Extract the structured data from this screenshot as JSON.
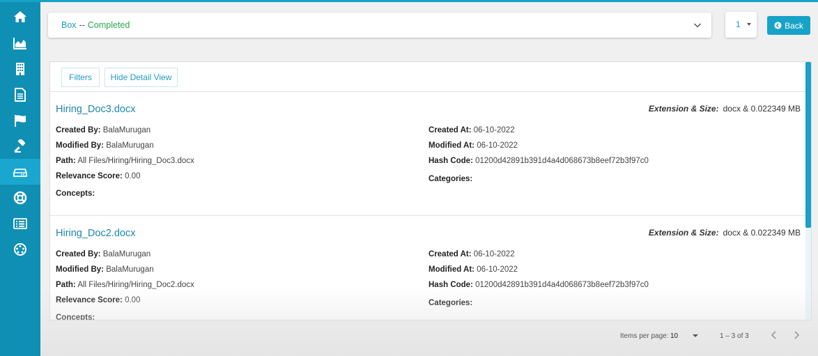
{
  "sidebar": {
    "items": [
      {
        "icon": "home-icon"
      },
      {
        "icon": "chart-area-icon"
      },
      {
        "icon": "building-icon"
      },
      {
        "icon": "document-icon"
      },
      {
        "icon": "flag-icon"
      },
      {
        "icon": "gavel-icon"
      },
      {
        "icon": "drive-icon",
        "active": true
      },
      {
        "icon": "lifebuoy-icon"
      },
      {
        "icon": "list-icon"
      },
      {
        "icon": "palette-icon"
      }
    ]
  },
  "header": {
    "crumb_source": "Box",
    "crumb_separator": "--",
    "crumb_status": "Completed"
  },
  "page_select": {
    "value": "1"
  },
  "back_button": {
    "label": "Back"
  },
  "toolbar": {
    "filters_label": "Filters",
    "detail_view_label": "Hide Detail View"
  },
  "documents": [
    {
      "name": "Hiring_Doc3.docx",
      "extension_label": "Extension & Size:",
      "extension_value": "docx & 0.022349 MB",
      "created_by_label": "Created By:",
      "created_by": "BalaMurugan",
      "modified_by_label": "Modified By:",
      "modified_by": "BalaMurugan",
      "path_label": "Path:",
      "path": "All Files/Hiring/Hiring_Doc3.docx",
      "relevance_label": "Relevance Score:",
      "relevance": "0.00",
      "concepts_label": "Concepts:",
      "created_at_label": "Created At:",
      "created_at": "06-10-2022",
      "modified_at_label": "Modified At:",
      "modified_at": "06-10-2022",
      "hash_label": "Hash Code:",
      "hash": "01200d42891b391d4a4d068673b8eef72b3f97c0",
      "categories_label": "Categories:"
    },
    {
      "name": "Hiring_Doc2.docx",
      "extension_label": "Extension & Size:",
      "extension_value": "docx & 0.022349 MB",
      "created_by_label": "Created By:",
      "created_by": "BalaMurugan",
      "modified_by_label": "Modified By:",
      "modified_by": "BalaMurugan",
      "path_label": "Path:",
      "path": "All Files/Hiring/Hiring_Doc2.docx",
      "relevance_label": "Relevance Score:",
      "relevance": "0.00",
      "concepts_label": "Concepts:",
      "created_at_label": "Created At:",
      "created_at": "06-10-2022",
      "modified_at_label": "Modified At:",
      "modified_at": "06-10-2022",
      "hash_label": "Hash Code:",
      "hash": "01200d42891b391d4a4d068673b8eef72b3f97c0",
      "categories_label": "Categories:"
    }
  ],
  "paginator": {
    "items_per_page_label": "Items per page:",
    "items_per_page": "10",
    "range": "1 – 3 of 3"
  },
  "colors": {
    "sidebar": "#0f8fb4",
    "accent": "#17a2c7",
    "link": "#1d86b0",
    "status": "#2aa84a"
  }
}
